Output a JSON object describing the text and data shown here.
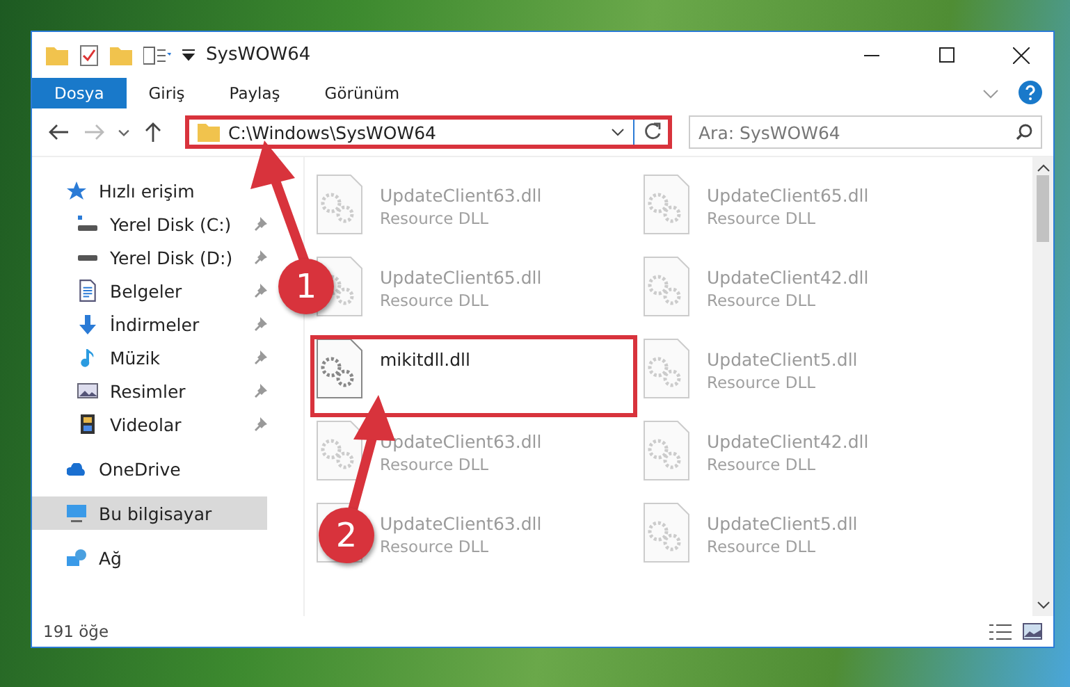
{
  "window": {
    "title": "SysWOW64"
  },
  "ribbon_tabs": [
    {
      "label": "Dosya",
      "selected": true
    },
    {
      "label": "Giriş",
      "selected": false
    },
    {
      "label": "Paylaş",
      "selected": false
    },
    {
      "label": "Görünüm",
      "selected": false
    }
  ],
  "address_bar": {
    "path": "C:\\Windows\\SysWOW64",
    "highlighted": true
  },
  "search": {
    "placeholder": "Ara: SysWOW64"
  },
  "sidebar": {
    "items": [
      {
        "label": "Hızlı erişim",
        "selected": false,
        "children": [
          {
            "label": "Yerel Disk (C:)",
            "pinned": true,
            "selected": false
          },
          {
            "label": "Yerel Disk (D:)",
            "pinned": true,
            "selected": false
          },
          {
            "label": "Belgeler",
            "pinned": true,
            "selected": false
          },
          {
            "label": "İndirmeler",
            "pinned": true,
            "selected": false
          },
          {
            "label": "Müzik",
            "pinned": true,
            "selected": false
          },
          {
            "label": "Resimler",
            "pinned": true,
            "selected": false
          },
          {
            "label": "Videolar",
            "pinned": true,
            "selected": false
          }
        ]
      },
      {
        "label": "OneDrive",
        "selected": false
      },
      {
        "label": "Bu bilgisayar",
        "selected": true
      },
      {
        "label": "Ağ",
        "selected": false
      }
    ]
  },
  "files": [
    {
      "name": "UpdateClient63.dll",
      "type": "Resource DLL",
      "faded": true,
      "highlighted": false
    },
    {
      "name": "UpdateClient65.dll",
      "type": "Resource DLL",
      "faded": true,
      "highlighted": false
    },
    {
      "name": "UpdateClient65.dll",
      "type": "Resource DLL",
      "faded": true,
      "highlighted": false
    },
    {
      "name": "UpdateClient42.dll",
      "type": "Resource DLL",
      "faded": true,
      "highlighted": false
    },
    {
      "name": "mikitdll.dll",
      "faded": false,
      "highlighted": true
    },
    {
      "name": "UpdateClient5.dll",
      "type": "Resource DLL",
      "faded": true,
      "highlighted": false
    },
    {
      "name": "UpdateClient63.dll",
      "type": "Resource DLL",
      "faded": true,
      "highlighted": false
    },
    {
      "name": "UpdateClient42.dll",
      "type": "Resource DLL",
      "faded": true,
      "highlighted": false
    },
    {
      "name": "UpdateClient63.dll",
      "type": "Resource DLL",
      "faded": true,
      "highlighted": false
    },
    {
      "name": "UpdateClient5.dll",
      "type": "Resource DLL",
      "faded": true,
      "highlighted": false
    }
  ],
  "status_bar": {
    "item_count": "191 öğe"
  },
  "annotations": [
    {
      "label": "1"
    },
    {
      "label": "2"
    }
  ]
}
